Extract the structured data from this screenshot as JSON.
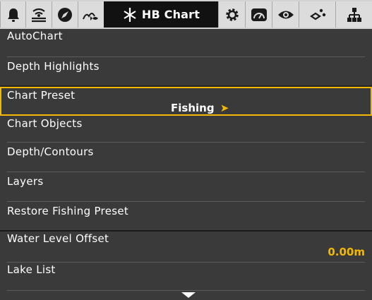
{
  "tabbar": {
    "active_label": "HB Chart",
    "icons": [
      "alarm-icon",
      "sonar-icon",
      "navigation-icon",
      "chart-fish-icon",
      "hb-chart-icon",
      "settings-gear-icon",
      "gauge-icon",
      "eye-icon",
      "network-icon",
      "hierarchy-icon"
    ]
  },
  "menu": {
    "items": [
      {
        "label": "AutoChart"
      },
      {
        "label": "Depth Highlights"
      },
      {
        "label": "Chart Preset",
        "value": "Fishing"
      },
      {
        "label": "Chart Objects"
      },
      {
        "label": "Depth/Contours"
      },
      {
        "label": "Layers"
      },
      {
        "label": "Restore Fishing Preset"
      },
      {
        "label": "Water Level Offset",
        "value": "0.00m"
      },
      {
        "label": "Lake List"
      }
    ]
  },
  "colors": {
    "accent": "#f5b800",
    "background": "#3a3a3a",
    "dark_row": "#262626",
    "tabbar": "#d2d2d2"
  }
}
